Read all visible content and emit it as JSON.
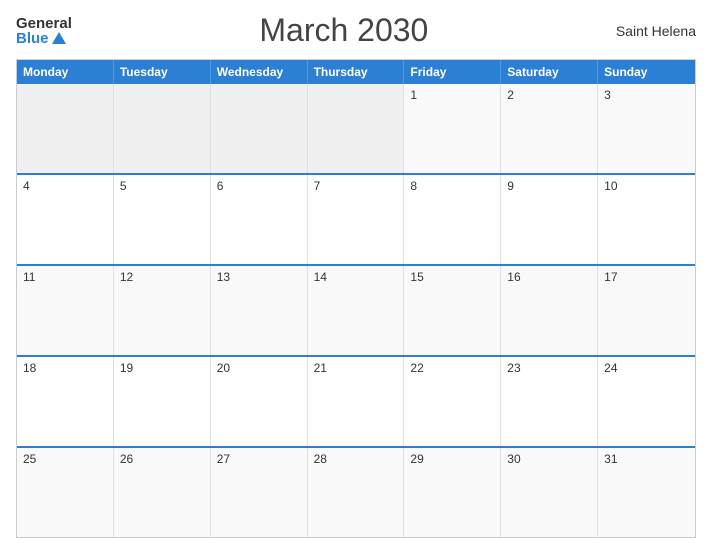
{
  "header": {
    "logo_general": "General",
    "logo_blue": "Blue",
    "title": "March 2030",
    "location": "Saint Helena"
  },
  "calendar": {
    "days": [
      "Monday",
      "Tuesday",
      "Wednesday",
      "Thursday",
      "Friday",
      "Saturday",
      "Sunday"
    ],
    "weeks": [
      [
        {
          "num": "",
          "empty": true
        },
        {
          "num": "",
          "empty": true
        },
        {
          "num": "",
          "empty": true
        },
        {
          "num": "",
          "empty": true
        },
        {
          "num": "1",
          "empty": false
        },
        {
          "num": "2",
          "empty": false
        },
        {
          "num": "3",
          "empty": false
        }
      ],
      [
        {
          "num": "4",
          "empty": false
        },
        {
          "num": "5",
          "empty": false
        },
        {
          "num": "6",
          "empty": false
        },
        {
          "num": "7",
          "empty": false
        },
        {
          "num": "8",
          "empty": false
        },
        {
          "num": "9",
          "empty": false
        },
        {
          "num": "10",
          "empty": false
        }
      ],
      [
        {
          "num": "11",
          "empty": false
        },
        {
          "num": "12",
          "empty": false
        },
        {
          "num": "13",
          "empty": false
        },
        {
          "num": "14",
          "empty": false
        },
        {
          "num": "15",
          "empty": false
        },
        {
          "num": "16",
          "empty": false
        },
        {
          "num": "17",
          "empty": false
        }
      ],
      [
        {
          "num": "18",
          "empty": false
        },
        {
          "num": "19",
          "empty": false
        },
        {
          "num": "20",
          "empty": false
        },
        {
          "num": "21",
          "empty": false
        },
        {
          "num": "22",
          "empty": false
        },
        {
          "num": "23",
          "empty": false
        },
        {
          "num": "24",
          "empty": false
        }
      ],
      [
        {
          "num": "25",
          "empty": false
        },
        {
          "num": "26",
          "empty": false
        },
        {
          "num": "27",
          "empty": false
        },
        {
          "num": "28",
          "empty": false
        },
        {
          "num": "29",
          "empty": false
        },
        {
          "num": "30",
          "empty": false
        },
        {
          "num": "31",
          "empty": false
        }
      ]
    ]
  }
}
